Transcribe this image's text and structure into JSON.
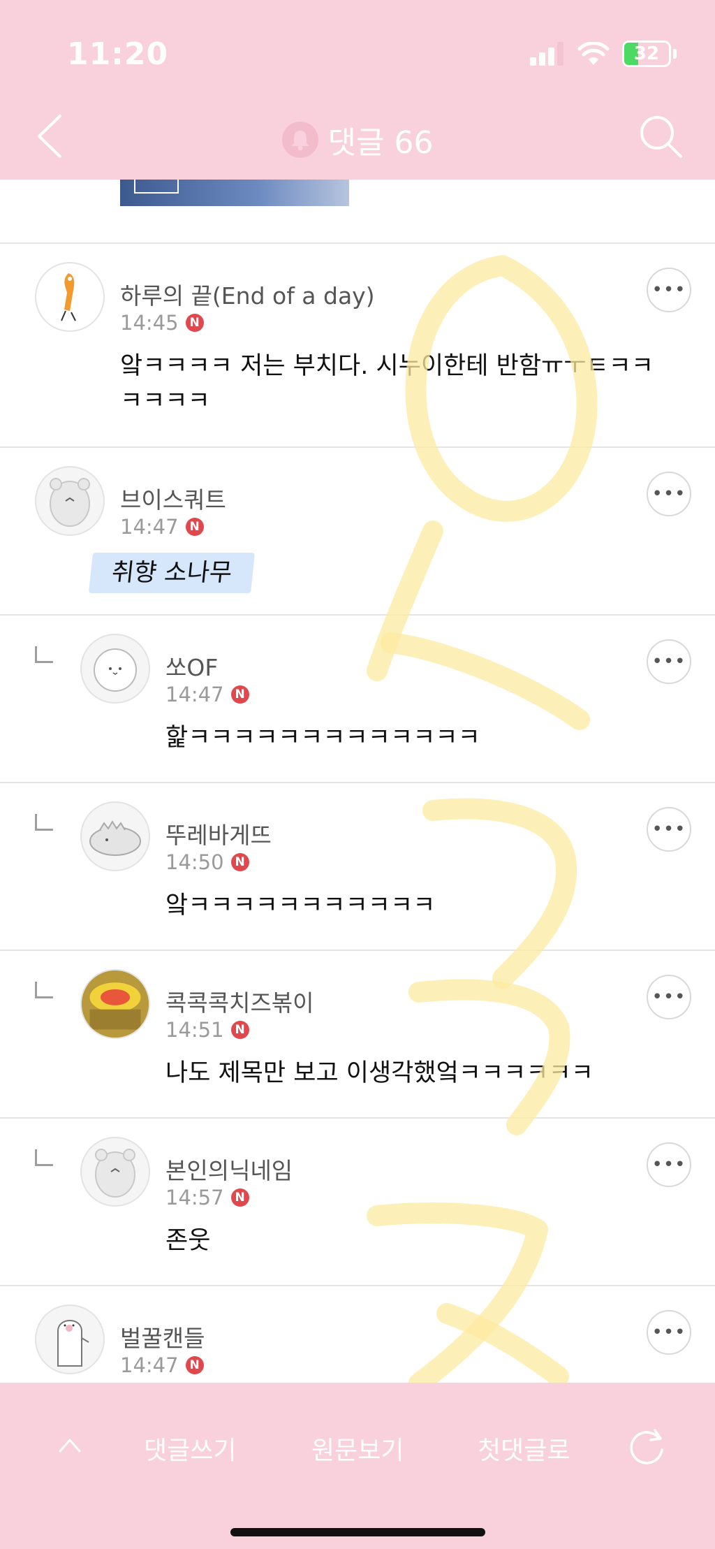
{
  "status_bar": {
    "time": "11:20",
    "battery": "32"
  },
  "header": {
    "title": "댓글 66"
  },
  "comments": [
    {
      "nick": "하루의 끝(End of a day)",
      "time": "14:45",
      "badge": "N",
      "text_line1": "앜ㅋㅋㅋㅋ 저는 부치다. 시누이한테 반함ㅠㅜㅌㅋㅋ",
      "text_line2": "ㅋㅋㅋㅋ"
    },
    {
      "nick": "브이스쿼트",
      "time": "14:47",
      "badge": "N",
      "text": "취향 소나무"
    },
    {
      "nick": "쏘OF",
      "time": "14:47",
      "badge": "N",
      "text": "핥ㅋㅋㅋㅋㅋㅋㅋㅋㅋㅋㅋㅋㅋ"
    },
    {
      "nick": "뚜레바게뜨",
      "time": "14:50",
      "badge": "N",
      "text": "앜ㅋㅋㅋㅋㅋㅋㅋㅋㅋㅋㅋ"
    },
    {
      "nick": "콕콕콕치즈볶이",
      "time": "14:51",
      "badge": "N",
      "text": "나도 제목만 보고 이생각했엌ㅋㅋㅋㅋㅋㅋ"
    },
    {
      "nick": "본인의닉네임",
      "time": "14:57",
      "badge": "N",
      "text": "존웃"
    },
    {
      "nick": "벌꿀캔들",
      "time": "14:47",
      "badge": "N"
    }
  ],
  "bottom_bar": {
    "write": "댓글쓰기",
    "original": "원문보기",
    "first": "첫댓글로"
  },
  "colors": {
    "header_bg": "#f8d1dc",
    "badge_red": "#e0484e",
    "highlight": "#d6e6fb"
  }
}
